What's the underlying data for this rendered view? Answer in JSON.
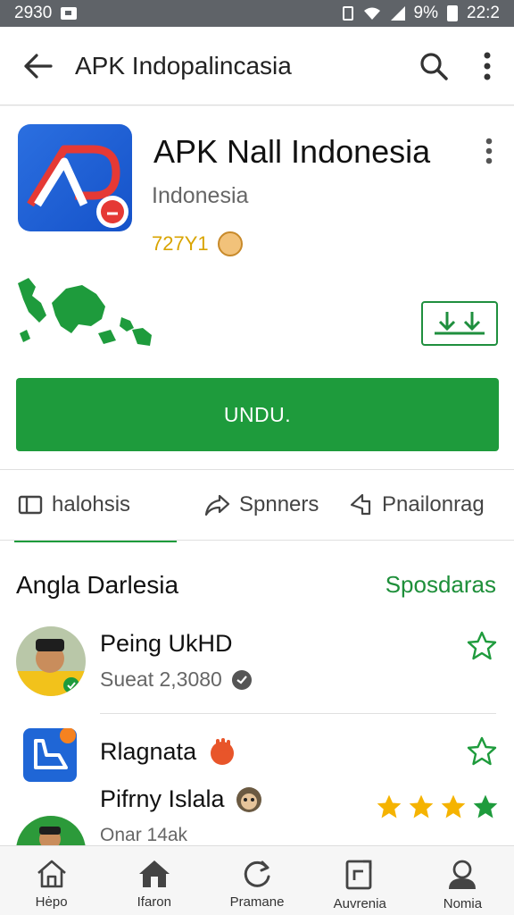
{
  "status_bar": {
    "time": "2930",
    "battery": "9%",
    "clock": "22:2"
  },
  "app_bar": {
    "title": "APK Indopalincasia"
  },
  "app": {
    "name": "APK Nall Indonesia",
    "publisher": "Indonesia",
    "rating_text": "727Y1",
    "install_label": "UNDU."
  },
  "tabs": [
    {
      "label": "halohsis",
      "icon": "book-icon"
    },
    {
      "label": "Spnners",
      "icon": "share-icon"
    },
    {
      "label": "Pnailonrag",
      "icon": "cursor-icon"
    }
  ],
  "section": {
    "title": "Angla Darlesia",
    "link": "Sposdaras"
  },
  "items": [
    {
      "title": "Peing UkHD",
      "sub": "Sueat 2,3080",
      "starred": false
    },
    {
      "title": "Rlagnata",
      "sub": "",
      "starred": false
    },
    {
      "title": "Pifrny Islala",
      "sub": "Onar 14ak",
      "stars": 4
    }
  ],
  "bottom_nav": [
    {
      "label": "Hėpo",
      "icon": "home-outline-icon"
    },
    {
      "label": "Ifaron",
      "icon": "home-filled-icon"
    },
    {
      "label": "Pramane",
      "icon": "refresh-icon"
    },
    {
      "label": "Auvrenia",
      "icon": "edit-doc-icon"
    },
    {
      "label": "Nomia",
      "icon": "profile-icon"
    }
  ],
  "colors": {
    "accent": "#1e9b3c",
    "status_bar": "#5f6368",
    "star_gold": "#f5b301"
  }
}
